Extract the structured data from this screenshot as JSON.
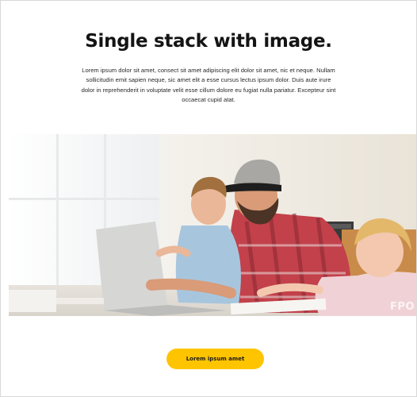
{
  "section": {
    "title": "Single stack with image.",
    "body": "Lorem ipsum dolor sit amet, consect sit amet adipiscing elit dolor sit amet, nic et neque. Nullam sollicitudin emit sapien neque, sic amet elit a esse cursus lectus ipsum dolor. Duis aute irure dolor in reprehenderit in voluptate velit esse cillum dolore eu fugiat nulla pariatur. Excepteur sint occaecat cupid atat."
  },
  "image": {
    "watermark": "FPO"
  },
  "cta": {
    "label": "Lorem ipsum amet",
    "color": "#ffc400"
  }
}
